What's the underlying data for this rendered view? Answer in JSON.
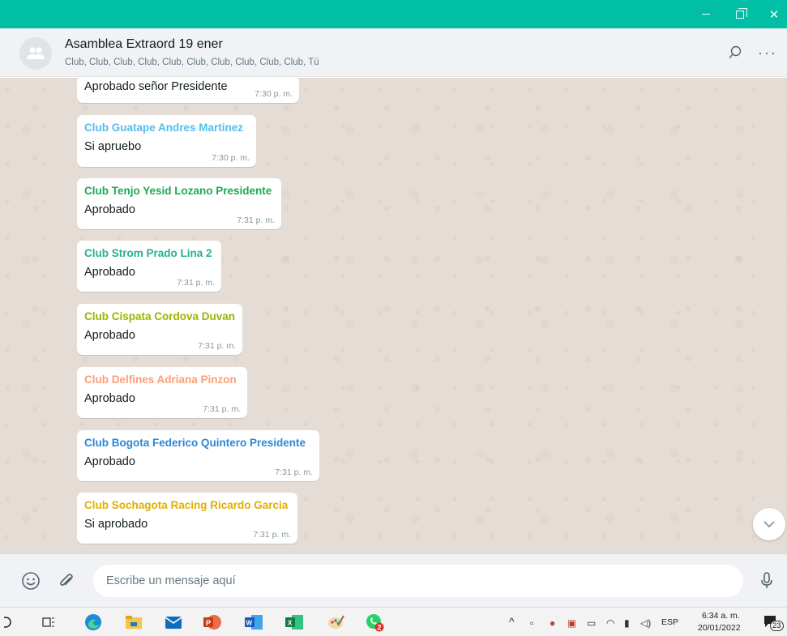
{
  "window": {
    "title_bar_color": "#00bfa5",
    "minimize_icon": "minimize-icon",
    "maximize_icon": "maximize-icon",
    "close_icon": "close-icon"
  },
  "chat": {
    "title": "Asamblea Extraord 19 ener",
    "participants": "Club, Club, Club, Club, Club, Club, Club, Club, Club, Club, Tú",
    "avatar_icon": "group-icon",
    "search_icon": "search-icon",
    "menu_icon": "more-icon",
    "menu_glyph": "···"
  },
  "messages": [
    {
      "author": "",
      "author_color": "",
      "text": "Aprobado señor Presidente",
      "time": "7:30 p. m."
    },
    {
      "author": "Club Guatape Andres Martinez",
      "author_color": "#53bdeb",
      "text": "Si apruebo",
      "time": "7:30 p. m."
    },
    {
      "author": "Club Tenjo Yesid Lozano Presidente",
      "author_color": "#1fa855",
      "text": "Aprobado",
      "time": "7:31 p. m."
    },
    {
      "author": "Club Strom Prado Lina 2",
      "author_color": "#25b28b",
      "text": "Aprobado",
      "time": "7:31 p. m."
    },
    {
      "author": "Club Cispata Cordova Duvan",
      "author_color": "#9fb300",
      "text": "Aprobado",
      "time": "7:31 p. m."
    },
    {
      "author": "Club Delfines Adriana Pinzon",
      "author_color": "#fa9f7a",
      "text": "Aprobado",
      "time": "7:31 p. m."
    },
    {
      "author": "Club Bogota Federico Quintero Presidente",
      "author_color": "#2f86d4",
      "text": "Aprobado",
      "time": "7:31 p. m."
    },
    {
      "author": "Club Sochagota Racing Ricardo Garcia",
      "author_color": "#e0b000",
      "text": "Si aprobado",
      "time": "7:31 p. m."
    }
  ],
  "composer": {
    "placeholder": "Escribe un mensaje aquí",
    "emoji_icon": "emoji-icon",
    "attach_icon": "attach-icon",
    "mic_icon": "mic-icon",
    "scroll_down_icon": "chevron-down-icon"
  },
  "taskbar": {
    "apps": [
      "cortana-icon",
      "task-view-icon",
      "edge-icon",
      "file-explorer-icon",
      "mail-icon",
      "powerpoint-icon",
      "word-icon",
      "excel-icon",
      "paint-icon",
      "whatsapp-icon"
    ],
    "whatsapp_badge": "2",
    "language": "ESP",
    "time": "6:34 a. m.",
    "date": "20/01/2022",
    "notification_count": "23"
  }
}
